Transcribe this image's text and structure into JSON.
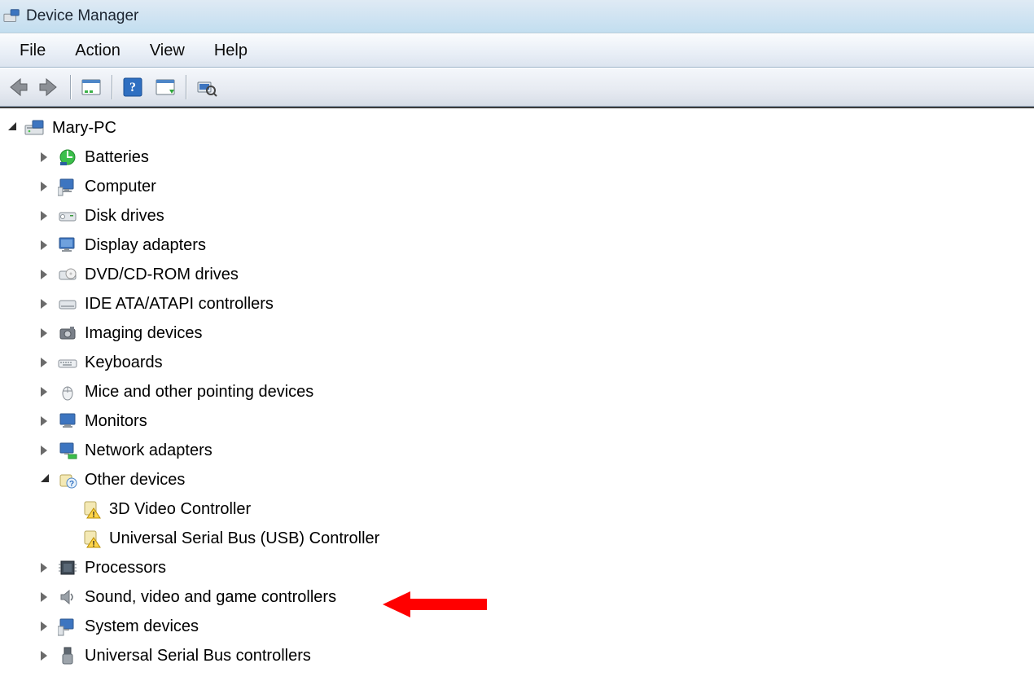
{
  "window": {
    "title": "Device Manager"
  },
  "menubar": {
    "items": [
      "File",
      "Action",
      "View",
      "Help"
    ]
  },
  "toolbar": {
    "back": {
      "name": "back-icon"
    },
    "fwd": {
      "name": "forward-icon"
    },
    "props": {
      "name": "properties-icon"
    },
    "help": {
      "name": "help-icon"
    },
    "scan": {
      "name": "scan-icon"
    },
    "find": {
      "name": "find-device-icon"
    }
  },
  "tree": {
    "root": {
      "label": "Mary-PC",
      "expanded": true,
      "icon": "computer-root-icon"
    },
    "categories": [
      {
        "label": "Batteries",
        "expanded": false,
        "icon": "battery-icon"
      },
      {
        "label": "Computer",
        "expanded": false,
        "icon": "computer-icon"
      },
      {
        "label": "Disk drives",
        "expanded": false,
        "icon": "disk-icon"
      },
      {
        "label": "Display adapters",
        "expanded": false,
        "icon": "display-icon"
      },
      {
        "label": "DVD/CD-ROM drives",
        "expanded": false,
        "icon": "dvd-icon"
      },
      {
        "label": "IDE ATA/ATAPI controllers",
        "expanded": false,
        "icon": "ide-icon"
      },
      {
        "label": "Imaging devices",
        "expanded": false,
        "icon": "imaging-icon"
      },
      {
        "label": "Keyboards",
        "expanded": false,
        "icon": "keyboard-icon"
      },
      {
        "label": "Mice and other pointing devices",
        "expanded": false,
        "icon": "mouse-icon"
      },
      {
        "label": "Monitors",
        "expanded": false,
        "icon": "monitor-icon"
      },
      {
        "label": "Network adapters",
        "expanded": false,
        "icon": "network-icon"
      },
      {
        "label": "Other devices",
        "expanded": true,
        "icon": "other-icon",
        "children": [
          {
            "label": "3D Video Controller",
            "icon": "warning-device-icon"
          },
          {
            "label": "Universal Serial Bus (USB) Controller",
            "icon": "warning-device-icon"
          }
        ]
      },
      {
        "label": "Processors",
        "expanded": false,
        "icon": "cpu-icon"
      },
      {
        "label": "Sound, video and game controllers",
        "expanded": false,
        "icon": "sound-icon"
      },
      {
        "label": "System devices",
        "expanded": false,
        "icon": "system-icon"
      },
      {
        "label": "Universal Serial Bus controllers",
        "expanded": false,
        "icon": "usb-icon"
      }
    ]
  },
  "annotation": {
    "type": "arrow",
    "points_to": "Sound, video and game controllers",
    "color": "#ff0000"
  }
}
